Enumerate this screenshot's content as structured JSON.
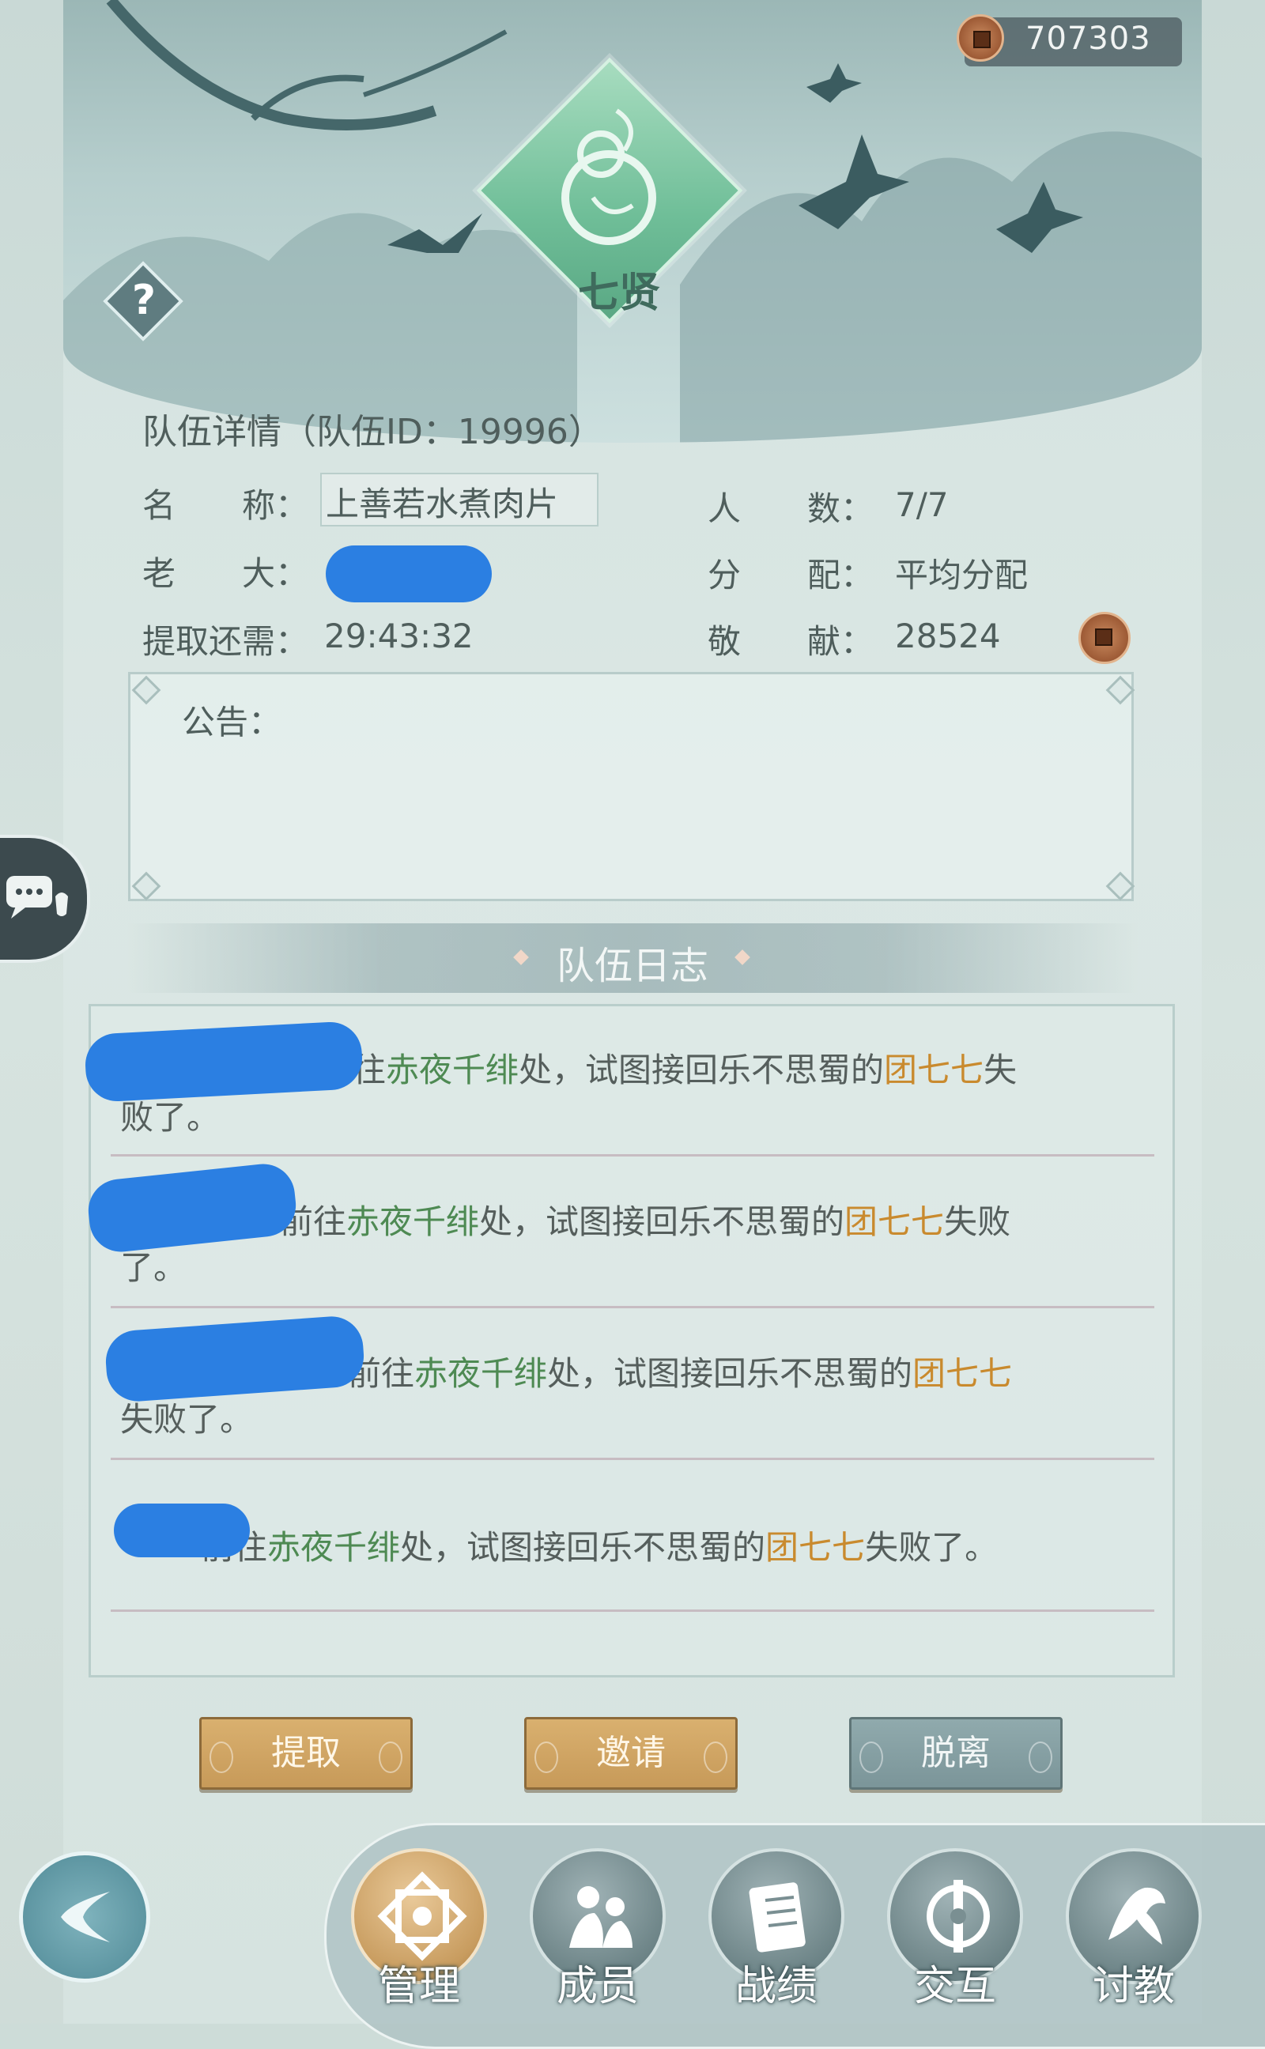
{
  "currency": {
    "icon": "coin-icon",
    "value": "707303"
  },
  "team": {
    "emblem_name": "七贤",
    "title": "队伍详情（队伍ID：19996）",
    "name_label": "名　　称：",
    "name_value": "上善若水煮肉片",
    "count_label": "人　　数：",
    "count_value": "7/7",
    "boss_label": "老　　大：",
    "dist_label": "分　　配：",
    "dist_value": "平均分配",
    "extract_label": "提取还需：",
    "extract_value": "29:43:32",
    "contrib_label": "敬　　献：",
    "contrib_value": "28524"
  },
  "notice": {
    "label": "公告："
  },
  "log": {
    "title": "队伍日志",
    "entries": [
      {
        "l1_pre": "往",
        "l1_green": "赤夜千绯",
        "l1_mid": "处，试图接回乐不思蜀的",
        "l1_orange": "团七七",
        "l1_post": "失",
        "l2": "败了。"
      },
      {
        "l1_pre": "前往",
        "l1_green": "赤夜千绯",
        "l1_mid": "处，试图接回乐不思蜀的",
        "l1_orange": "团七七",
        "l1_post": "失败",
        "l2": "了。"
      },
      {
        "l1_pre": "前往",
        "l1_green": "赤夜千绯",
        "l1_mid": "处，试图接回乐不思蜀的",
        "l1_orange": "团七七",
        "l1_post": "",
        "l2": "失败了。"
      },
      {
        "l1_pre": "前往",
        "l1_green": "赤夜千绯",
        "l1_mid": "处，试图接回乐不思蜀的",
        "l1_orange": "团七七",
        "l1_post": "失败了。",
        "l2": ""
      }
    ]
  },
  "buttons": {
    "extract": "提取",
    "invite": "邀请",
    "leave": "脱离"
  },
  "nav": {
    "items": [
      {
        "label": "管理",
        "icon": "manage-icon",
        "active": true
      },
      {
        "label": "成员",
        "icon": "members-icon",
        "active": false
      },
      {
        "label": "战绩",
        "icon": "records-icon",
        "active": false
      },
      {
        "label": "交互",
        "icon": "interact-icon",
        "active": false
      },
      {
        "label": "讨教",
        "icon": "spar-icon",
        "active": false
      }
    ]
  },
  "colors": {
    "green_text": "#4e8a53",
    "orange_text": "#c98a2e",
    "gold_button": "#c79a59",
    "grey_button": "#7b9599",
    "redaction": "#2b7fe2"
  }
}
